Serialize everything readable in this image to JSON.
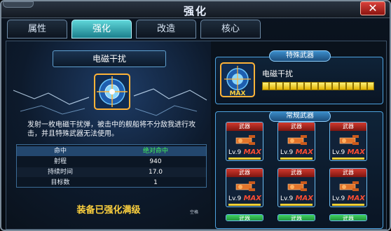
{
  "window": {
    "title": "强化"
  },
  "tabs": [
    {
      "label": "属性",
      "active": false
    },
    {
      "label": "强化",
      "active": true
    },
    {
      "label": "改造",
      "active": false
    },
    {
      "label": "核心",
      "active": false
    }
  ],
  "weapon": {
    "name": "电磁干扰",
    "description": "发射一枚电磁干扰弹，被击中的舰船将不分敌我进行攻击，并且特殊武器无法使用。",
    "stats": [
      {
        "key": "命中",
        "value": "绝对命中",
        "highlight": true
      },
      {
        "key": "射程",
        "value": "940"
      },
      {
        "key": "持续时间",
        "value": "17.0"
      },
      {
        "key": "目标数",
        "value": "1"
      }
    ],
    "status": "装备已强化满级",
    "tiny_label": "空格"
  },
  "special_weapon": {
    "header": "特殊武器",
    "name": "电磁干扰",
    "icon_badge": "MAX",
    "bar_segments_filled": 16,
    "bar_segments_total": 16
  },
  "regular_weapons": {
    "header": "常规武器",
    "cards": [
      {
        "type": "武器",
        "level": "Lv.9",
        "badge": "MAX",
        "icon": "cannon-icon"
      },
      {
        "type": "武器",
        "level": "Lv.9",
        "badge": "MAX",
        "icon": "cannon-icon"
      },
      {
        "type": "武器",
        "level": "Lv.9",
        "badge": "MAX",
        "icon": "cannon-icon"
      },
      {
        "type": "武器",
        "level": "Lv.9",
        "badge": "MAX",
        "icon": "cannon-icon"
      },
      {
        "type": "武器",
        "level": "Lv.9",
        "badge": "MAX",
        "icon": "cannon-icon"
      },
      {
        "type": "武器",
        "level": "Lv.9",
        "badge": "MAX",
        "icon": "cannon-icon"
      }
    ],
    "stubs": [
      {
        "type": "武器"
      },
      {
        "type": "武器"
      },
      {
        "type": "武器"
      }
    ]
  },
  "colors": {
    "accent": "#5fd6d9",
    "highlight_value": "#43f25c",
    "max_badge": "#ff4d32",
    "status_text": "#ffd23e",
    "bar": "#f2d033"
  }
}
